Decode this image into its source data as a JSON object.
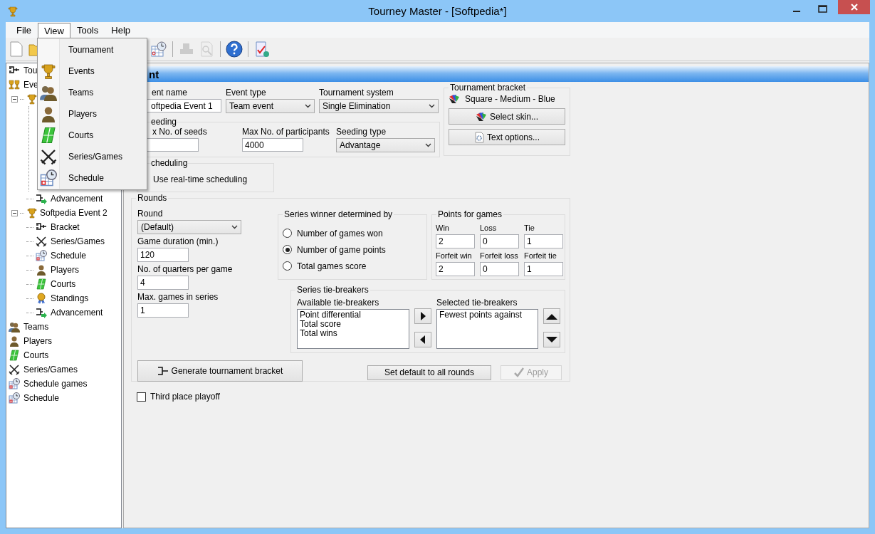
{
  "window": {
    "title": "Tourney Master - [Softpedia*]"
  },
  "menu_bar": [
    {
      "label": "File",
      "selected": false
    },
    {
      "label": "View",
      "selected": true
    },
    {
      "label": "Tools",
      "selected": false
    },
    {
      "label": "Help",
      "selected": false
    }
  ],
  "view_menu": [
    {
      "label": "Tournament",
      "kind": "none"
    },
    {
      "label": "Events",
      "kind": "trophy"
    },
    {
      "label": "Teams",
      "kind": "teams"
    },
    {
      "label": "Players",
      "kind": "player"
    },
    {
      "label": "Courts",
      "kind": "court"
    },
    {
      "label": "Series/Games",
      "kind": "swords"
    },
    {
      "label": "Schedule",
      "kind": "schedule"
    }
  ],
  "toolbar": [
    {
      "kind": "new",
      "disabled": false
    },
    {
      "kind": "open",
      "disabled": false
    },
    {
      "kind": "hidden"
    },
    {
      "kind": "schedule",
      "disabled": false
    },
    {
      "kind": "separator"
    },
    {
      "kind": "print",
      "disabled": true
    },
    {
      "kind": "preview",
      "disabled": true
    },
    {
      "kind": "separator"
    },
    {
      "kind": "help",
      "disabled": false
    },
    {
      "kind": "separator"
    },
    {
      "kind": "check",
      "disabled": false
    }
  ],
  "tree": [
    {
      "label": "Tou",
      "kind": "bracket"
    },
    {
      "label": "Eve",
      "kind": "trophies",
      "children": [
        {
          "kind": "trophy",
          "expanded": true,
          "children": [
            {
              "label": "Advancement",
              "kind": "advance"
            }
          ]
        },
        {
          "label": "Softpedia Event 2",
          "kind": "trophy",
          "expanded": true,
          "children": [
            {
              "label": "Bracket",
              "kind": "bracket"
            },
            {
              "label": "Series/Games",
              "kind": "swords"
            },
            {
              "label": "Schedule",
              "kind": "schedule"
            },
            {
              "label": "Players",
              "kind": "player"
            },
            {
              "label": "Courts",
              "kind": "court"
            },
            {
              "label": "Standings",
              "kind": "medal"
            },
            {
              "label": "Advancement",
              "kind": "advance"
            }
          ]
        }
      ]
    },
    {
      "label": "Teams",
      "kind": "teams"
    },
    {
      "label": "Players",
      "kind": "player"
    },
    {
      "label": "Courts",
      "kind": "court"
    },
    {
      "label": "Series/Games",
      "kind": "swords"
    },
    {
      "label": "Schedule games",
      "kind": "schedule"
    },
    {
      "label": "Schedule",
      "kind": "schedule"
    }
  ],
  "panel": {
    "title": "nt",
    "event_name": {
      "label": "ent name",
      "value": "oftpedia Event 1"
    },
    "event_type": {
      "label": "Event type",
      "value": "Team event"
    },
    "tournament_system": {
      "label": "Tournament system",
      "value": "Single Elimination"
    },
    "seeding": {
      "title": "eeding",
      "max_seeds": {
        "label": "x No. of seeds"
      },
      "max_participants": {
        "label": "Max No. of participants",
        "value": "4000"
      },
      "seeding_type": {
        "label": "Seeding type",
        "value": "Advantage"
      }
    },
    "scheduling": {
      "title": "cheduling",
      "label": "Use real-time scheduling"
    },
    "bracket": {
      "title": "Tournament bracket",
      "skin": "Square - Medium - Blue",
      "select_skin": "Select skin...",
      "text_options": "Text options..."
    },
    "rounds": {
      "title": "Rounds",
      "round": {
        "label": "Round",
        "value": "(Default)"
      },
      "fields": [
        {
          "label": "Game duration (min.)",
          "value": "120"
        },
        {
          "label": "No. of quarters per game",
          "value": "4"
        },
        {
          "label": "Max. games in series",
          "value": "1"
        }
      ],
      "series_winner": {
        "title": "Series winner determined by",
        "options": [
          {
            "label": "Number of games won",
            "selected": false
          },
          {
            "label": "Number of game points",
            "selected": true
          },
          {
            "label": "Total games score",
            "selected": false
          }
        ]
      },
      "points": {
        "title": "Points for games",
        "fields": [
          {
            "label": "Win",
            "value": "2"
          },
          {
            "label": "Loss",
            "value": "0"
          },
          {
            "label": "Tie",
            "value": "1"
          },
          {
            "label": "Forfeit win",
            "value": "2"
          },
          {
            "label": "Forfeit loss",
            "value": "0"
          },
          {
            "label": "Forfeit tie",
            "value": "1"
          }
        ]
      },
      "tie_breakers": {
        "title": "Series tie-breakers",
        "available": {
          "label": "Available tie-breakers",
          "items": [
            "Point differential",
            "Total score",
            "Total wins"
          ]
        },
        "selected": {
          "label": "Selected tie-breakers",
          "items": [
            "Fewest points against"
          ]
        }
      },
      "generate": "Generate tournament bracket",
      "set_default": "Set default to all rounds",
      "apply": {
        "label": "Apply",
        "disabled": true
      }
    },
    "third_place": {
      "label": "Third place playoff",
      "checked": false
    }
  }
}
